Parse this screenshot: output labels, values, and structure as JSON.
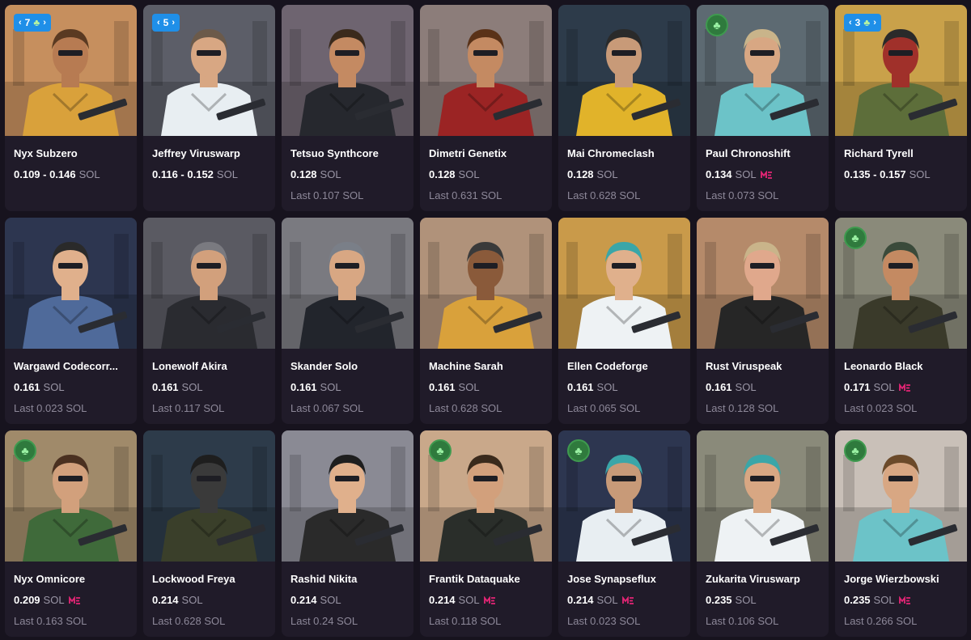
{
  "colors": {
    "page_bg": "#17131e",
    "card_bg": "#201b29",
    "badge_blue": "#1f8fe8",
    "clover_green": "#2f7a3d",
    "me_pink": "#e42575",
    "muted_text": "#8d8899"
  },
  "cards": [
    {
      "name": "Nyx Subzero",
      "price": "0.109 - 0.146",
      "unit": "SOL",
      "last": "",
      "me": false,
      "badge": {
        "type": "count",
        "value": "7",
        "clover": true
      },
      "bg": "#c68f5e",
      "skin": "#b77b52",
      "outfit": "#d9a13b",
      "hair": "#5a3a22"
    },
    {
      "name": "Jeffrey Viruswarp",
      "price": "0.116 - 0.152",
      "unit": "SOL",
      "last": "",
      "me": false,
      "badge": {
        "type": "count",
        "value": "5",
        "clover": false
      },
      "bg": "#5c5e68",
      "skin": "#d8a783",
      "outfit": "#e8eef2",
      "hair": "#6b5a4a"
    },
    {
      "name": "Tetsuo Synthcore",
      "price": "0.128",
      "unit": "SOL",
      "last": "Last 0.107 SOL",
      "me": false,
      "badge": null,
      "bg": "#6e6470",
      "skin": "#c48a62",
      "outfit": "#26282e",
      "hair": "#3a2a1c"
    },
    {
      "name": "Dimetri Genetix",
      "price": "0.128",
      "unit": "SOL",
      "last": "Last 0.631 SOL",
      "me": false,
      "badge": null,
      "bg": "#8c7d7a",
      "skin": "#c48a62",
      "outfit": "#9b2424",
      "hair": "#5a3218"
    },
    {
      "name": "Mai Chromeclash",
      "price": "0.128",
      "unit": "SOL",
      "last": "Last 0.628 SOL",
      "me": false,
      "badge": null,
      "bg": "#2d3b4a",
      "skin": "#c89a78",
      "outfit": "#e1b32a",
      "hair": "#2a2a2a"
    },
    {
      "name": "Paul Chronoshift",
      "price": "0.134",
      "unit": "SOL",
      "last": "Last 0.073 SOL",
      "me": true,
      "badge": {
        "type": "clover"
      },
      "bg": "#5d6a72",
      "skin": "#d8a783",
      "outfit": "#6cc3c8",
      "hair": "#c9b48a"
    },
    {
      "name": "Richard Tyrell",
      "price": "0.135 - 0.157",
      "unit": "SOL",
      "last": "",
      "me": false,
      "badge": {
        "type": "count",
        "value": "3",
        "clover": true
      },
      "bg": "#c9a14a",
      "skin": "#a0302a",
      "outfit": "#5d6e3a",
      "hair": "#2a2a2a"
    },
    {
      "name": "Wargawd Codecorr...",
      "price": "0.161",
      "unit": "SOL",
      "last": "Last 0.023 SOL",
      "me": false,
      "badge": null,
      "bg": "#2d3650",
      "skin": "#e0b08c",
      "outfit": "#4f6a9a",
      "hair": "#2a2a2a"
    },
    {
      "name": "Lonewolf Akira",
      "price": "0.161",
      "unit": "SOL",
      "last": "Last 0.117 SOL",
      "me": false,
      "badge": null,
      "bg": "#5a5a62",
      "skin": "#d2a07c",
      "outfit": "#2a2b30",
      "hair": "#7a7a80"
    },
    {
      "name": "Skander Solo",
      "price": "0.161",
      "unit": "SOL",
      "last": "Last 0.067 SOL",
      "me": false,
      "badge": null,
      "bg": "#7a7a80",
      "skin": "#d8a783",
      "outfit": "#22252c",
      "hair": "#7a7f88"
    },
    {
      "name": "Machine Sarah",
      "price": "0.161",
      "unit": "SOL",
      "last": "Last 0.628 SOL",
      "me": false,
      "badge": null,
      "bg": "#b0927a",
      "skin": "#8a5a3a",
      "outfit": "#d9a13b",
      "hair": "#3a3a3a"
    },
    {
      "name": "Ellen Codeforge",
      "price": "0.161",
      "unit": "SOL",
      "last": "Last 0.065 SOL",
      "me": false,
      "badge": null,
      "bg": "#c99a4a",
      "skin": "#e0b08c",
      "outfit": "#eef2f4",
      "hair": "#3aa6a8"
    },
    {
      "name": "Rust Viruspeak",
      "price": "0.161",
      "unit": "SOL",
      "last": "Last 0.128 SOL",
      "me": false,
      "badge": null,
      "bg": "#b58a6a",
      "skin": "#e0a88c",
      "outfit": "#262626",
      "hair": "#c9b48a"
    },
    {
      "name": "Leonardo Black",
      "price": "0.171",
      "unit": "SOL",
      "last": "Last 0.023 SOL",
      "me": true,
      "badge": {
        "type": "clover"
      },
      "bg": "#8a8a7a",
      "skin": "#c48a62",
      "outfit": "#3a3a2a",
      "hair": "#3a4a3a"
    },
    {
      "name": "Nyx Omnicore",
      "price": "0.209",
      "unit": "SOL",
      "last": "Last 0.163 SOL",
      "me": true,
      "badge": {
        "type": "clover"
      },
      "bg": "#a08a6a",
      "skin": "#d2a07c",
      "outfit": "#3f6a3a",
      "hair": "#4a3020"
    },
    {
      "name": "Lockwood Freya",
      "price": "0.214",
      "unit": "SOL",
      "last": "Last 0.628 SOL",
      "me": false,
      "badge": null,
      "bg": "#2d3b4a",
      "skin": "#3a3a3a",
      "outfit": "#3a3f2a",
      "hair": "#1e1e1e"
    },
    {
      "name": "Rashid Nikita",
      "price": "0.214",
      "unit": "SOL",
      "last": "Last 0.24 SOL",
      "me": false,
      "badge": null,
      "bg": "#8a8a94",
      "skin": "#e0b08c",
      "outfit": "#2a2a2a",
      "hair": "#1e1e1e"
    },
    {
      "name": "Frantik Dataquake",
      "price": "0.214",
      "unit": "SOL",
      "last": "Last 0.118 SOL",
      "me": true,
      "badge": {
        "type": "clover"
      },
      "bg": "#c9a88a",
      "skin": "#d2a07c",
      "outfit": "#2a2e2a",
      "hair": "#3a2a1c"
    },
    {
      "name": "Jose Synapseflux",
      "price": "0.214",
      "unit": "SOL",
      "last": "Last 0.023 SOL",
      "me": true,
      "badge": {
        "type": "clover"
      },
      "bg": "#2d3650",
      "skin": "#c89a78",
      "outfit": "#e8eef2",
      "hair": "#3aa6a8"
    },
    {
      "name": "Zukarita Viruswarp",
      "price": "0.235",
      "unit": "SOL",
      "last": "Last 0.106 SOL",
      "me": false,
      "badge": null,
      "bg": "#8a8a7a",
      "skin": "#d8a783",
      "outfit": "#eef2f4",
      "hair": "#3aa6a8"
    },
    {
      "name": "Jorge Wierzbowski",
      "price": "0.235",
      "unit": "SOL",
      "last": "Last 0.266 SOL",
      "me": true,
      "badge": {
        "type": "clover"
      },
      "bg": "#c9c0b8",
      "skin": "#d8a783",
      "outfit": "#6cc3c8",
      "hair": "#6b4a2a"
    }
  ]
}
